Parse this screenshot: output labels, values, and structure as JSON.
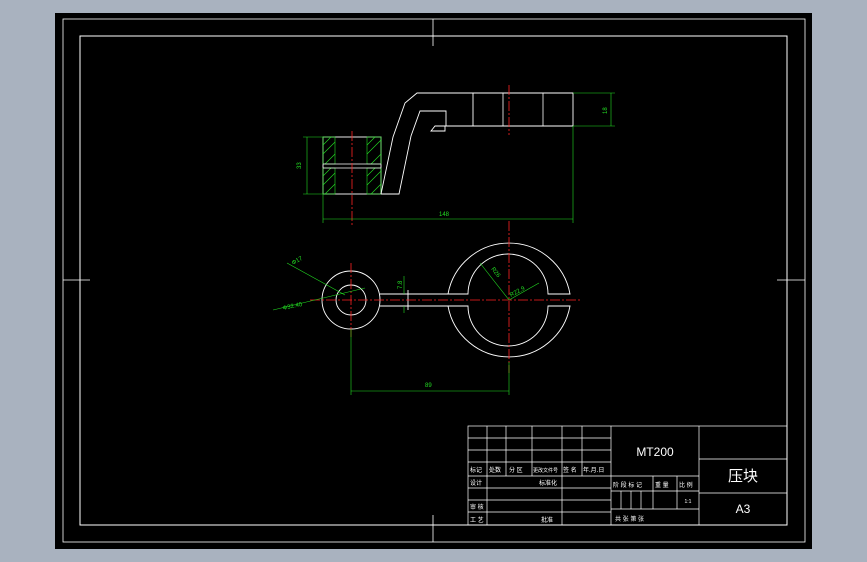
{
  "drawing": {
    "model_code": "MT200",
    "part_name": "压块",
    "sheet_size": "A3",
    "scale_value": "1:1",
    "colors": {
      "background": "#000000",
      "outline": "#ffffff",
      "centerline": "#ff2222",
      "dimension": "#22dd22",
      "hatch": "#22dd22",
      "app_border": "#a9b2bf"
    }
  },
  "dimensions": {
    "thickness_left": "33",
    "thickness_right": "18",
    "overall_length": "148",
    "small_dia": "Φ17",
    "small_bore": "Φ32.40",
    "slot_width": "7.8",
    "big_radius": "R26",
    "big_bore": "R22.9",
    "center_distance": "89"
  },
  "title_block": {
    "label_mark": "标记",
    "label_count": "处数",
    "label_zone": "分 区",
    "label_doc_no": "更改文件号",
    "label_sign": "签 名",
    "label_date": "年.月.日",
    "label_design": "设计",
    "label_standard": "标准化",
    "label_stage": "阶 段 标 记",
    "label_weight": "重 量",
    "label_scale": "比 例",
    "label_review": "审 核",
    "label_process": "工 艺",
    "label_approve": "批准",
    "label_sheets": "共  张  第  张"
  }
}
